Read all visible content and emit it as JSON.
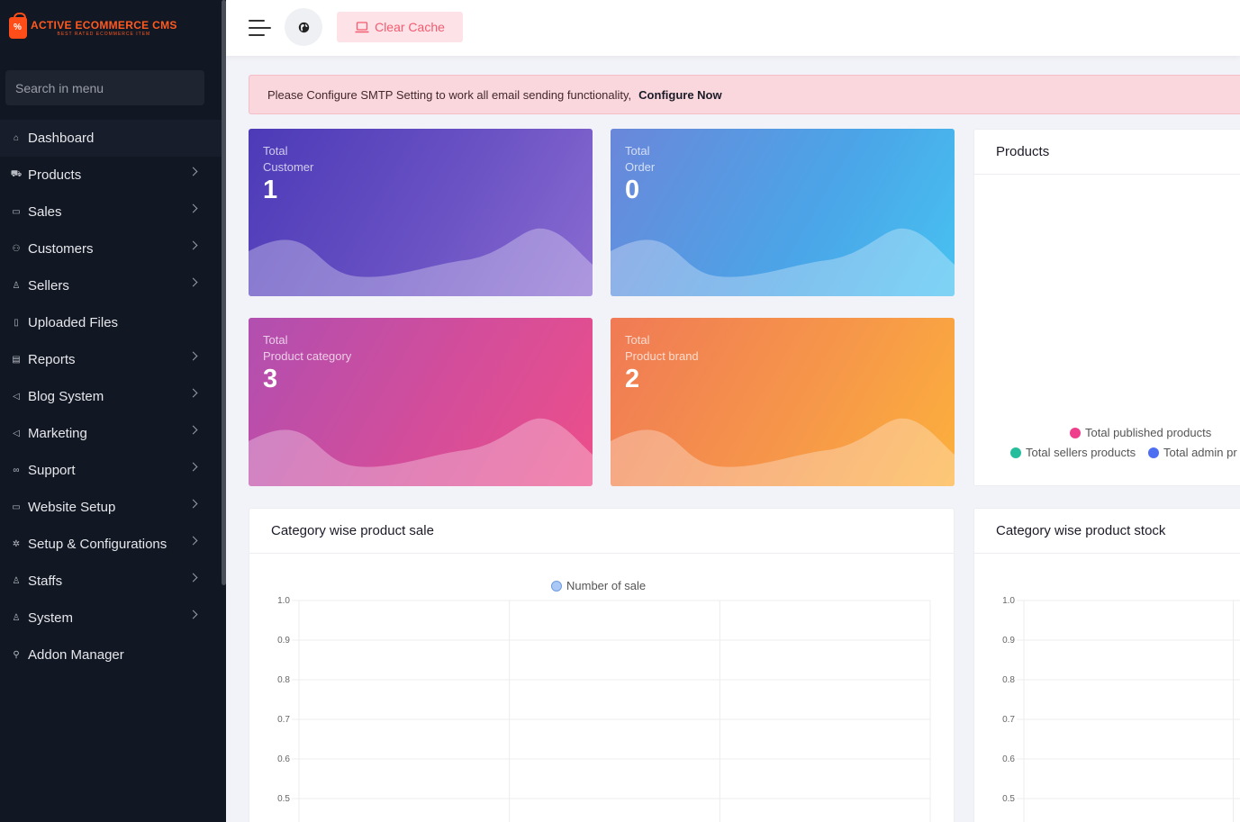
{
  "app": {
    "logo_name": "ACTIVE ECOMMERCE CMS",
    "logo_tag": "BEST RATED ECOMMERCE ITEM"
  },
  "sidebar": {
    "search_placeholder": "Search in menu",
    "items": [
      {
        "label": "Dashboard",
        "icon": "home-icon",
        "has_children": false,
        "active": true
      },
      {
        "label": "Products",
        "icon": "cart-icon",
        "has_children": true
      },
      {
        "label": "Sales",
        "icon": "money-icon",
        "has_children": true
      },
      {
        "label": "Customers",
        "icon": "users-icon",
        "has_children": true
      },
      {
        "label": "Sellers",
        "icon": "user-icon",
        "has_children": true
      },
      {
        "label": "Uploaded Files",
        "icon": "folder-icon",
        "has_children": false
      },
      {
        "label": "Reports",
        "icon": "file-icon",
        "has_children": true
      },
      {
        "label": "Blog System",
        "icon": "bullhorn-icon",
        "has_children": true
      },
      {
        "label": "Marketing",
        "icon": "bullhorn-icon",
        "has_children": true
      },
      {
        "label": "Support",
        "icon": "link-icon",
        "has_children": true
      },
      {
        "label": "Website Setup",
        "icon": "desktop-icon",
        "has_children": true
      },
      {
        "label": "Setup & Configurations",
        "icon": "dharmachakra-icon",
        "has_children": true
      },
      {
        "label": "Staffs",
        "icon": "user-icon",
        "has_children": true
      },
      {
        "label": "System",
        "icon": "user-icon",
        "has_children": true
      },
      {
        "label": "Addon Manager",
        "icon": "wrench-icon",
        "has_children": false
      }
    ]
  },
  "topbar": {
    "clear_cache_label": "Clear Cache"
  },
  "alert": {
    "message": "Please Configure SMTP Setting to work all email sending functionality,",
    "link_label": "Configure Now"
  },
  "stats": [
    {
      "line1": "Total",
      "line2": "Customer",
      "value": "1"
    },
    {
      "line1": "Total",
      "line2": "Order",
      "value": "0"
    },
    {
      "line1": "Total",
      "line2": "Product category",
      "value": "3"
    },
    {
      "line1": "Total",
      "line2": "Product brand",
      "value": "2"
    }
  ],
  "colors": {
    "published": "#ef3f8c",
    "sellers": "#25bd9c",
    "admin": "#4f6ff2",
    "sale_series": "#a9c8f5"
  },
  "products_panel": {
    "title": "Products",
    "legend": [
      "Total published products",
      "Total sellers products",
      "Total admin pr"
    ]
  },
  "sale_panel": {
    "title": "Category wise product sale",
    "legend": "Number of sale"
  },
  "stock_panel": {
    "title": "Category wise product stock"
  },
  "chart_data": [
    {
      "type": "bar",
      "title": "Category wise product sale",
      "series": [
        {
          "name": "Number of sale",
          "values": []
        }
      ],
      "categories": [],
      "y_ticks": [
        "1.0",
        "0.9",
        "0.8",
        "0.7",
        "0.6",
        "0.5"
      ],
      "ylim": [
        0.5,
        1.0
      ],
      "x_gridlines": 3,
      "grid": true,
      "legend": "top"
    },
    {
      "type": "bar",
      "title": "Category wise product stock",
      "series": [],
      "categories": [],
      "y_ticks": [
        "1.0",
        "0.9",
        "0.8",
        "0.7",
        "0.6",
        "0.5"
      ],
      "ylim": [
        0.5,
        1.0
      ],
      "grid": true
    }
  ]
}
